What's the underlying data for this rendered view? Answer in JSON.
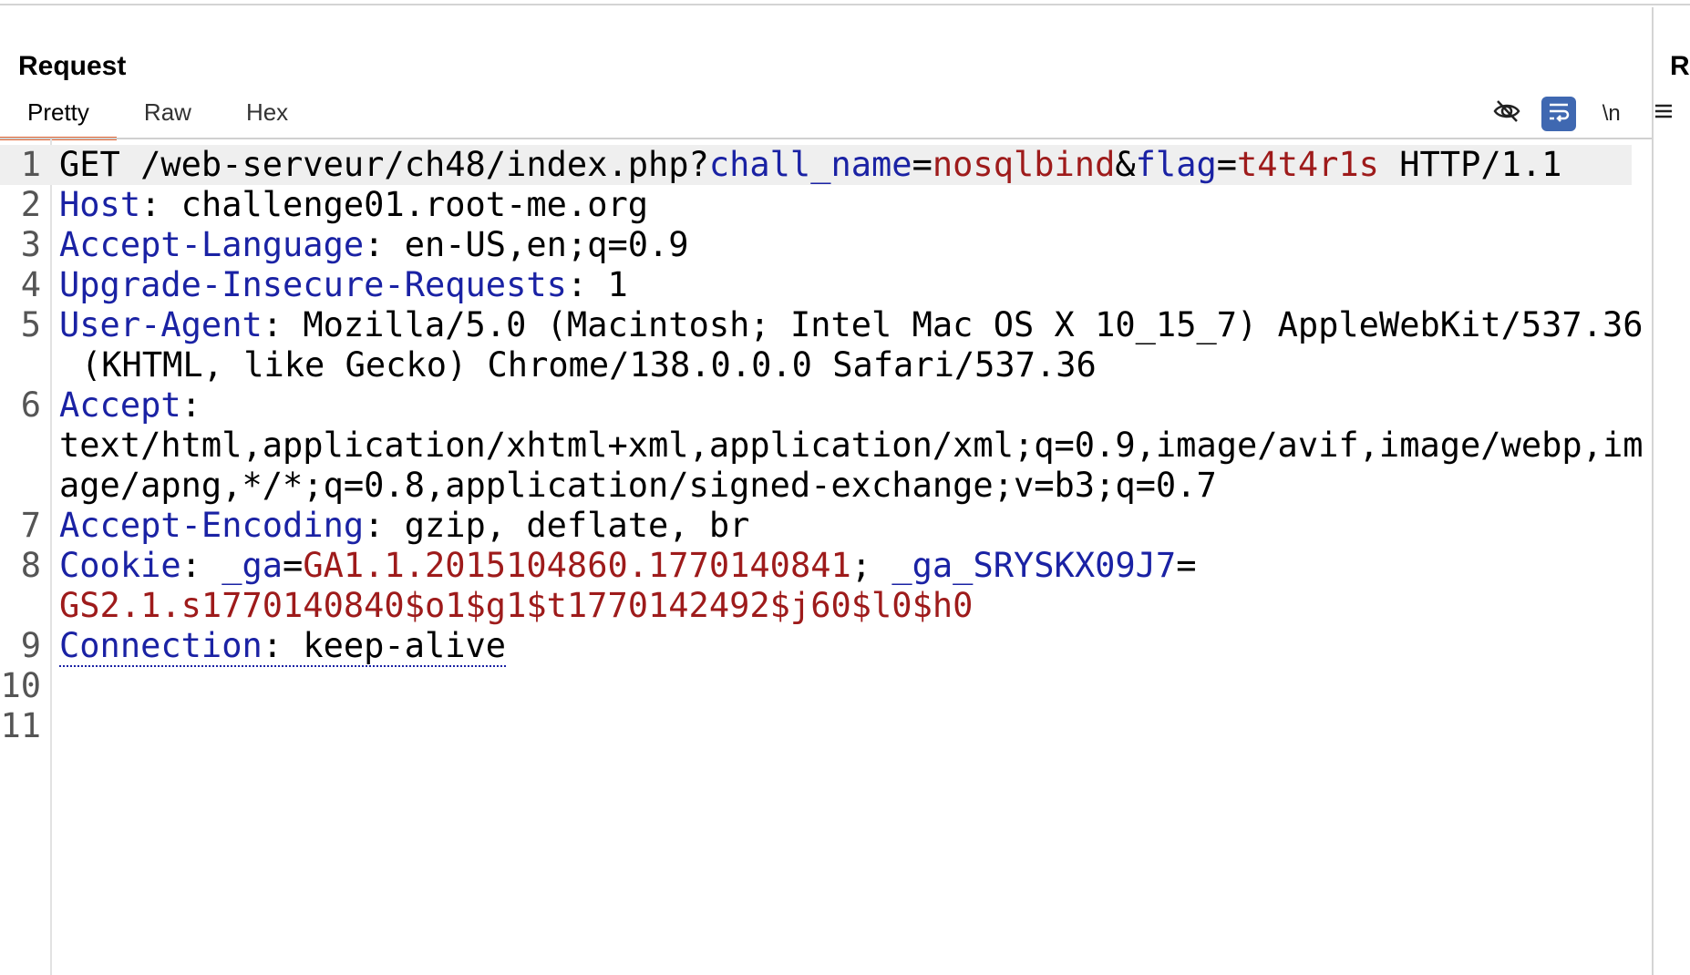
{
  "request_panel": {
    "title": "Request",
    "tabs": [
      "Pretty",
      "Raw",
      "Hex"
    ],
    "active_tab": "Pretty",
    "toolbar": {
      "hide_icon": "eye-slash-icon",
      "wrap_icon": "word-wrap-icon",
      "newline_label": "\\n",
      "menu_icon": "hamburger-icon"
    }
  },
  "response_panel": {
    "title_fragment": "R"
  },
  "colors": {
    "key": "#1a22a4",
    "value": "#9e1b1b",
    "tab_accent": "#e36a3a",
    "toggle_on": "#3f68b1"
  },
  "request": {
    "line_numbers": [
      "1",
      "2",
      "3",
      "4",
      "5",
      "6",
      "7",
      "8",
      "9",
      "10",
      "11"
    ],
    "request_line": {
      "method_path": "GET /web-serveur/ch48/index.php?",
      "p1_name": "chall_name",
      "eq1": "=",
      "p1_value": "nosqlbind",
      "amp": "&",
      "p2_name": "flag",
      "eq2": "=",
      "p2_value": "t4t4r1s",
      "protocol": " HTTP/1.1"
    },
    "headers": {
      "host": {
        "name": "Host",
        "sep": ": ",
        "value": "challenge01.root-me.org"
      },
      "accept_language": {
        "name": "Accept-Language",
        "sep": ": ",
        "value": "en-US,en;q=0.9"
      },
      "upgrade": {
        "name": "Upgrade-Insecure-Requests",
        "sep": ": ",
        "value": "1"
      },
      "user_agent": {
        "name": "User-Agent",
        "sep": ": ",
        "value": "Mozilla/5.0 (Macintosh; Intel Mac OS X 10_15_7) AppleWebKit/537.36 (KHTML, like Gecko) Chrome/138.0.0.0 Safari/537.36"
      },
      "accept": {
        "name": "Accept",
        "sep": ":",
        "value": "text/html,application/xhtml+xml,application/xml;q=0.9,image/avif,image/webp,image/apng,*/*;q=0.8,application/signed-exchange;v=b3;q=0.7"
      },
      "accept_encoding": {
        "name": "Accept-Encoding",
        "sep": ": ",
        "value": "gzip, deflate, br"
      },
      "cookie": {
        "name": "Cookie",
        "sep": ": ",
        "c1_name": "_ga",
        "eq": "=",
        "c1_value": "GA1.1.2015104860.1770140841",
        "delim": "; ",
        "c2_name": "_ga_SRYSKX09J7",
        "c2_value": "GS2.1.s1770140840$o1$g1$t1770142492$j60$l0$h0"
      },
      "connection": {
        "name": "Connection",
        "sep": ": ",
        "value": "keep-alive"
      }
    }
  }
}
